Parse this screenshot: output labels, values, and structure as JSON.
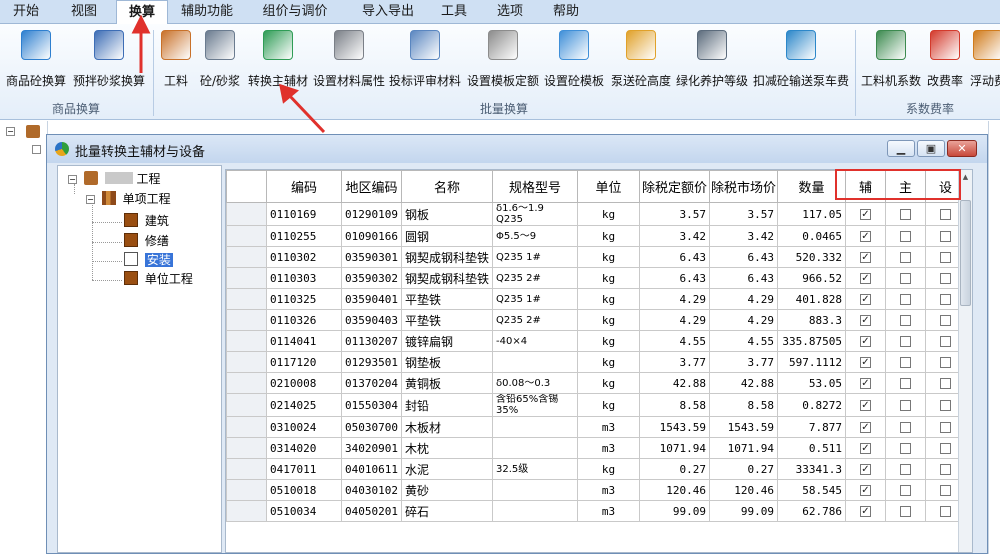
{
  "tabs": [
    {
      "label": "开始",
      "active": false
    },
    {
      "label": "视图",
      "active": false
    },
    {
      "label": "换算",
      "active": true
    },
    {
      "label": "辅助功能",
      "active": false
    },
    {
      "label": "组价与调价",
      "active": false
    },
    {
      "label": "导入导出",
      "active": false
    },
    {
      "label": "工具",
      "active": false
    },
    {
      "label": "选项",
      "active": false
    },
    {
      "label": "帮助",
      "active": false
    }
  ],
  "ribbon": {
    "groups": [
      {
        "label": "商品换算",
        "buttons": [
          {
            "label": "商品砼换算",
            "icon": "commodity-concrete-icon"
          },
          {
            "label": "预拌砂浆换算",
            "icon": "premix-mortar-icon"
          }
        ]
      },
      {
        "label": "批量换算",
        "buttons": [
          {
            "label": "工料",
            "icon": "brick-icon"
          },
          {
            "label": "砼/砂浆",
            "icon": "concrete-mortar-icon"
          },
          {
            "label": "转换主辅材",
            "icon": "convert-material-icon"
          },
          {
            "label": "设置材料属性",
            "icon": "material-property-icon"
          },
          {
            "label": "投标评审材料",
            "icon": "bid-review-icon"
          },
          {
            "label": "设置模板定额",
            "icon": "template-quota-icon"
          },
          {
            "label": "设置砼模板",
            "icon": "concrete-template-icon"
          },
          {
            "label": "泵送砼高度",
            "icon": "pump-truck-icon"
          },
          {
            "label": "绿化养护等级",
            "icon": "greening-icon"
          },
          {
            "label": "扣减砼输送泵车费",
            "icon": "deduct-pump-icon"
          }
        ]
      },
      {
        "label": "系数费率",
        "buttons": [
          {
            "label": "工料机系数",
            "icon": "coefficient-icon"
          },
          {
            "label": "改费率",
            "icon": "percent-icon"
          },
          {
            "label": "浮动费",
            "icon": "float-fee-icon"
          }
        ]
      }
    ]
  },
  "dialog": {
    "title": "批量转换主辅材与设备",
    "tree": {
      "root": "工程",
      "single": "单项工程",
      "items": [
        "建筑",
        "修缮",
        "安装",
        "单位工程"
      ],
      "selected": "安装"
    },
    "columns": [
      "编码",
      "地区编码",
      "名称",
      "规格型号",
      "单位",
      "除税定额价",
      "除税市场价",
      "数量",
      "辅",
      "主",
      "设"
    ],
    "rows": [
      {
        "code": "0110169",
        "area": "01290109",
        "name": "钢板",
        "spec": "δ1.6～1.9 Q235",
        "unit": "kg",
        "quota": "3.57",
        "market": "3.57",
        "qty": "117.05",
        "fu": true,
        "zhu": false,
        "she": false
      },
      {
        "code": "0110255",
        "area": "01090166",
        "name": "圆钢",
        "spec": "Φ5.5～9",
        "unit": "kg",
        "quota": "3.42",
        "market": "3.42",
        "qty": "0.0465",
        "fu": true,
        "zhu": false,
        "she": false
      },
      {
        "code": "0110302",
        "area": "03590301",
        "name": "钢契成钢科垫铁",
        "spec": "Q235 1#",
        "unit": "kg",
        "quota": "6.43",
        "market": "6.43",
        "qty": "520.332",
        "fu": true,
        "zhu": false,
        "she": false
      },
      {
        "code": "0110303",
        "area": "03590302",
        "name": "钢契成钢科垫铁",
        "spec": "Q235 2#",
        "unit": "kg",
        "quota": "6.43",
        "market": "6.43",
        "qty": "966.52",
        "fu": true,
        "zhu": false,
        "she": false
      },
      {
        "code": "0110325",
        "area": "03590401",
        "name": "平垫铁",
        "spec": "Q235 1#",
        "unit": "kg",
        "quota": "4.29",
        "market": "4.29",
        "qty": "401.828",
        "fu": true,
        "zhu": false,
        "she": false
      },
      {
        "code": "0110326",
        "area": "03590403",
        "name": "平垫铁",
        "spec": "Q235 2#",
        "unit": "kg",
        "quota": "4.29",
        "market": "4.29",
        "qty": "883.3",
        "fu": true,
        "zhu": false,
        "she": false
      },
      {
        "code": "0114041",
        "area": "01130207",
        "name": "镀锌扁钢",
        "spec": "-40×4",
        "unit": "kg",
        "quota": "4.55",
        "market": "4.55",
        "qty": "335.87505",
        "fu": true,
        "zhu": false,
        "she": false
      },
      {
        "code": "0117120",
        "area": "01293501",
        "name": "钢垫板",
        "spec": "",
        "unit": "kg",
        "quota": "3.77",
        "market": "3.77",
        "qty": "597.1112",
        "fu": true,
        "zhu": false,
        "she": false
      },
      {
        "code": "0210008",
        "area": "01370204",
        "name": "黄铜板",
        "spec": "δ0.08～0.3",
        "unit": "kg",
        "quota": "42.88",
        "market": "42.88",
        "qty": "53.05",
        "fu": true,
        "zhu": false,
        "she": false
      },
      {
        "code": "0214025",
        "area": "01550304",
        "name": "封铅",
        "spec": "含铅65%含锡35%",
        "unit": "kg",
        "quota": "8.58",
        "market": "8.58",
        "qty": "0.8272",
        "fu": true,
        "zhu": false,
        "she": false
      },
      {
        "code": "0310024",
        "area": "05030700",
        "name": "木板材",
        "spec": "",
        "unit": "m3",
        "quota": "1543.59",
        "market": "1543.59",
        "qty": "7.877",
        "fu": true,
        "zhu": false,
        "she": false
      },
      {
        "code": "0314020",
        "area": "34020901",
        "name": "木枕",
        "spec": "",
        "unit": "m3",
        "quota": "1071.94",
        "market": "1071.94",
        "qty": "0.511",
        "fu": true,
        "zhu": false,
        "she": false
      },
      {
        "code": "0417011",
        "area": "04010611",
        "name": "水泥",
        "spec": "32.5级",
        "unit": "kg",
        "quota": "0.27",
        "market": "0.27",
        "qty": "33341.3",
        "fu": true,
        "zhu": false,
        "she": false
      },
      {
        "code": "0510018",
        "area": "04030102",
        "name": "黄砂",
        "spec": "",
        "unit": "m3",
        "quota": "120.46",
        "market": "120.46",
        "qty": "58.545",
        "fu": true,
        "zhu": false,
        "she": false
      },
      {
        "code": "0510034",
        "area": "04050201",
        "name": "碎石",
        "spec": "",
        "unit": "m3",
        "quota": "99.09",
        "market": "99.09",
        "qty": "62.786",
        "fu": true,
        "zhu": false,
        "she": false
      }
    ]
  }
}
